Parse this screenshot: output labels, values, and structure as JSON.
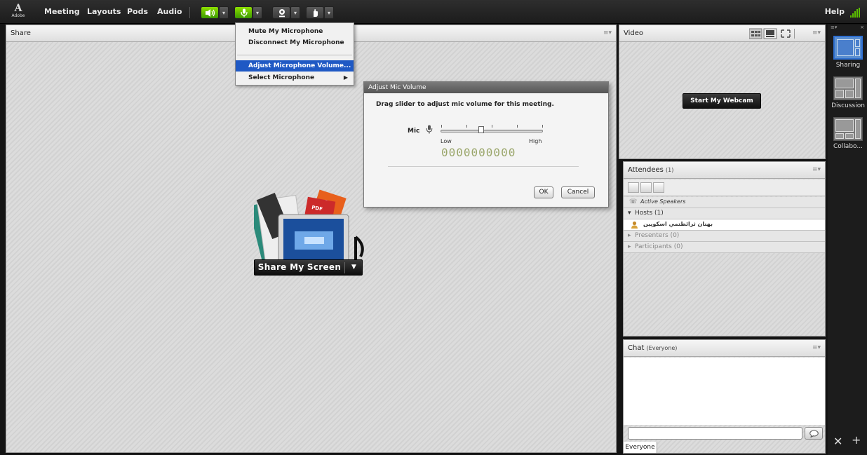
{
  "menubar": {
    "logo": "Adobe",
    "items": [
      "Meeting",
      "Layouts",
      "Pods",
      "Audio"
    ],
    "help": "Help",
    "icons": [
      "speaker-icon",
      "microphone-icon",
      "webcam-icon",
      "raise-hand-icon"
    ]
  },
  "mic_menu": {
    "items": [
      {
        "label": "Mute My Microphone"
      },
      {
        "label": "Disconnect My Microphone"
      },
      {
        "label": "Adjust Microphone Volume..."
      },
      {
        "label": "Select Microphone"
      }
    ],
    "highlighted": "Adjust Microphone Volume..."
  },
  "share_pod": {
    "title": "Share",
    "share_button": "Share My Screen",
    "art_labels": [
      "PPT",
      "PDF"
    ]
  },
  "video_pod": {
    "title": "Video",
    "webcam_button": "Start My Webcam"
  },
  "attendees_pod": {
    "title": "Attendees",
    "count": "(1)",
    "active_speakers": "Active Speakers",
    "hosts": "Hosts (1)",
    "host_name": "بهنان ثرائطتمي اسكوپين",
    "presenters": "Presenters (0)",
    "participants": "Participants (0)"
  },
  "chat_pod": {
    "title": "Chat",
    "scope": "(Everyone)",
    "tab": "Everyone"
  },
  "layouts": [
    {
      "label": "Sharing",
      "selected": true
    },
    {
      "label": "Discussion",
      "selected": false
    },
    {
      "label": "Collabo...",
      "selected": false
    }
  ],
  "dialog": {
    "title": "Adjust Mic Volume",
    "message": "Drag slider to adjust mic volume for this meeting.",
    "mic_label": "Mic",
    "low": "Low",
    "high": "High",
    "meter": "0000000000",
    "slider_value": 0.4,
    "ok": "OK",
    "cancel": "Cancel"
  },
  "colors": {
    "accent_green": "#5cc000",
    "menu_highlight": "#1f59c4",
    "selected_layout": "#2f6fcf"
  }
}
